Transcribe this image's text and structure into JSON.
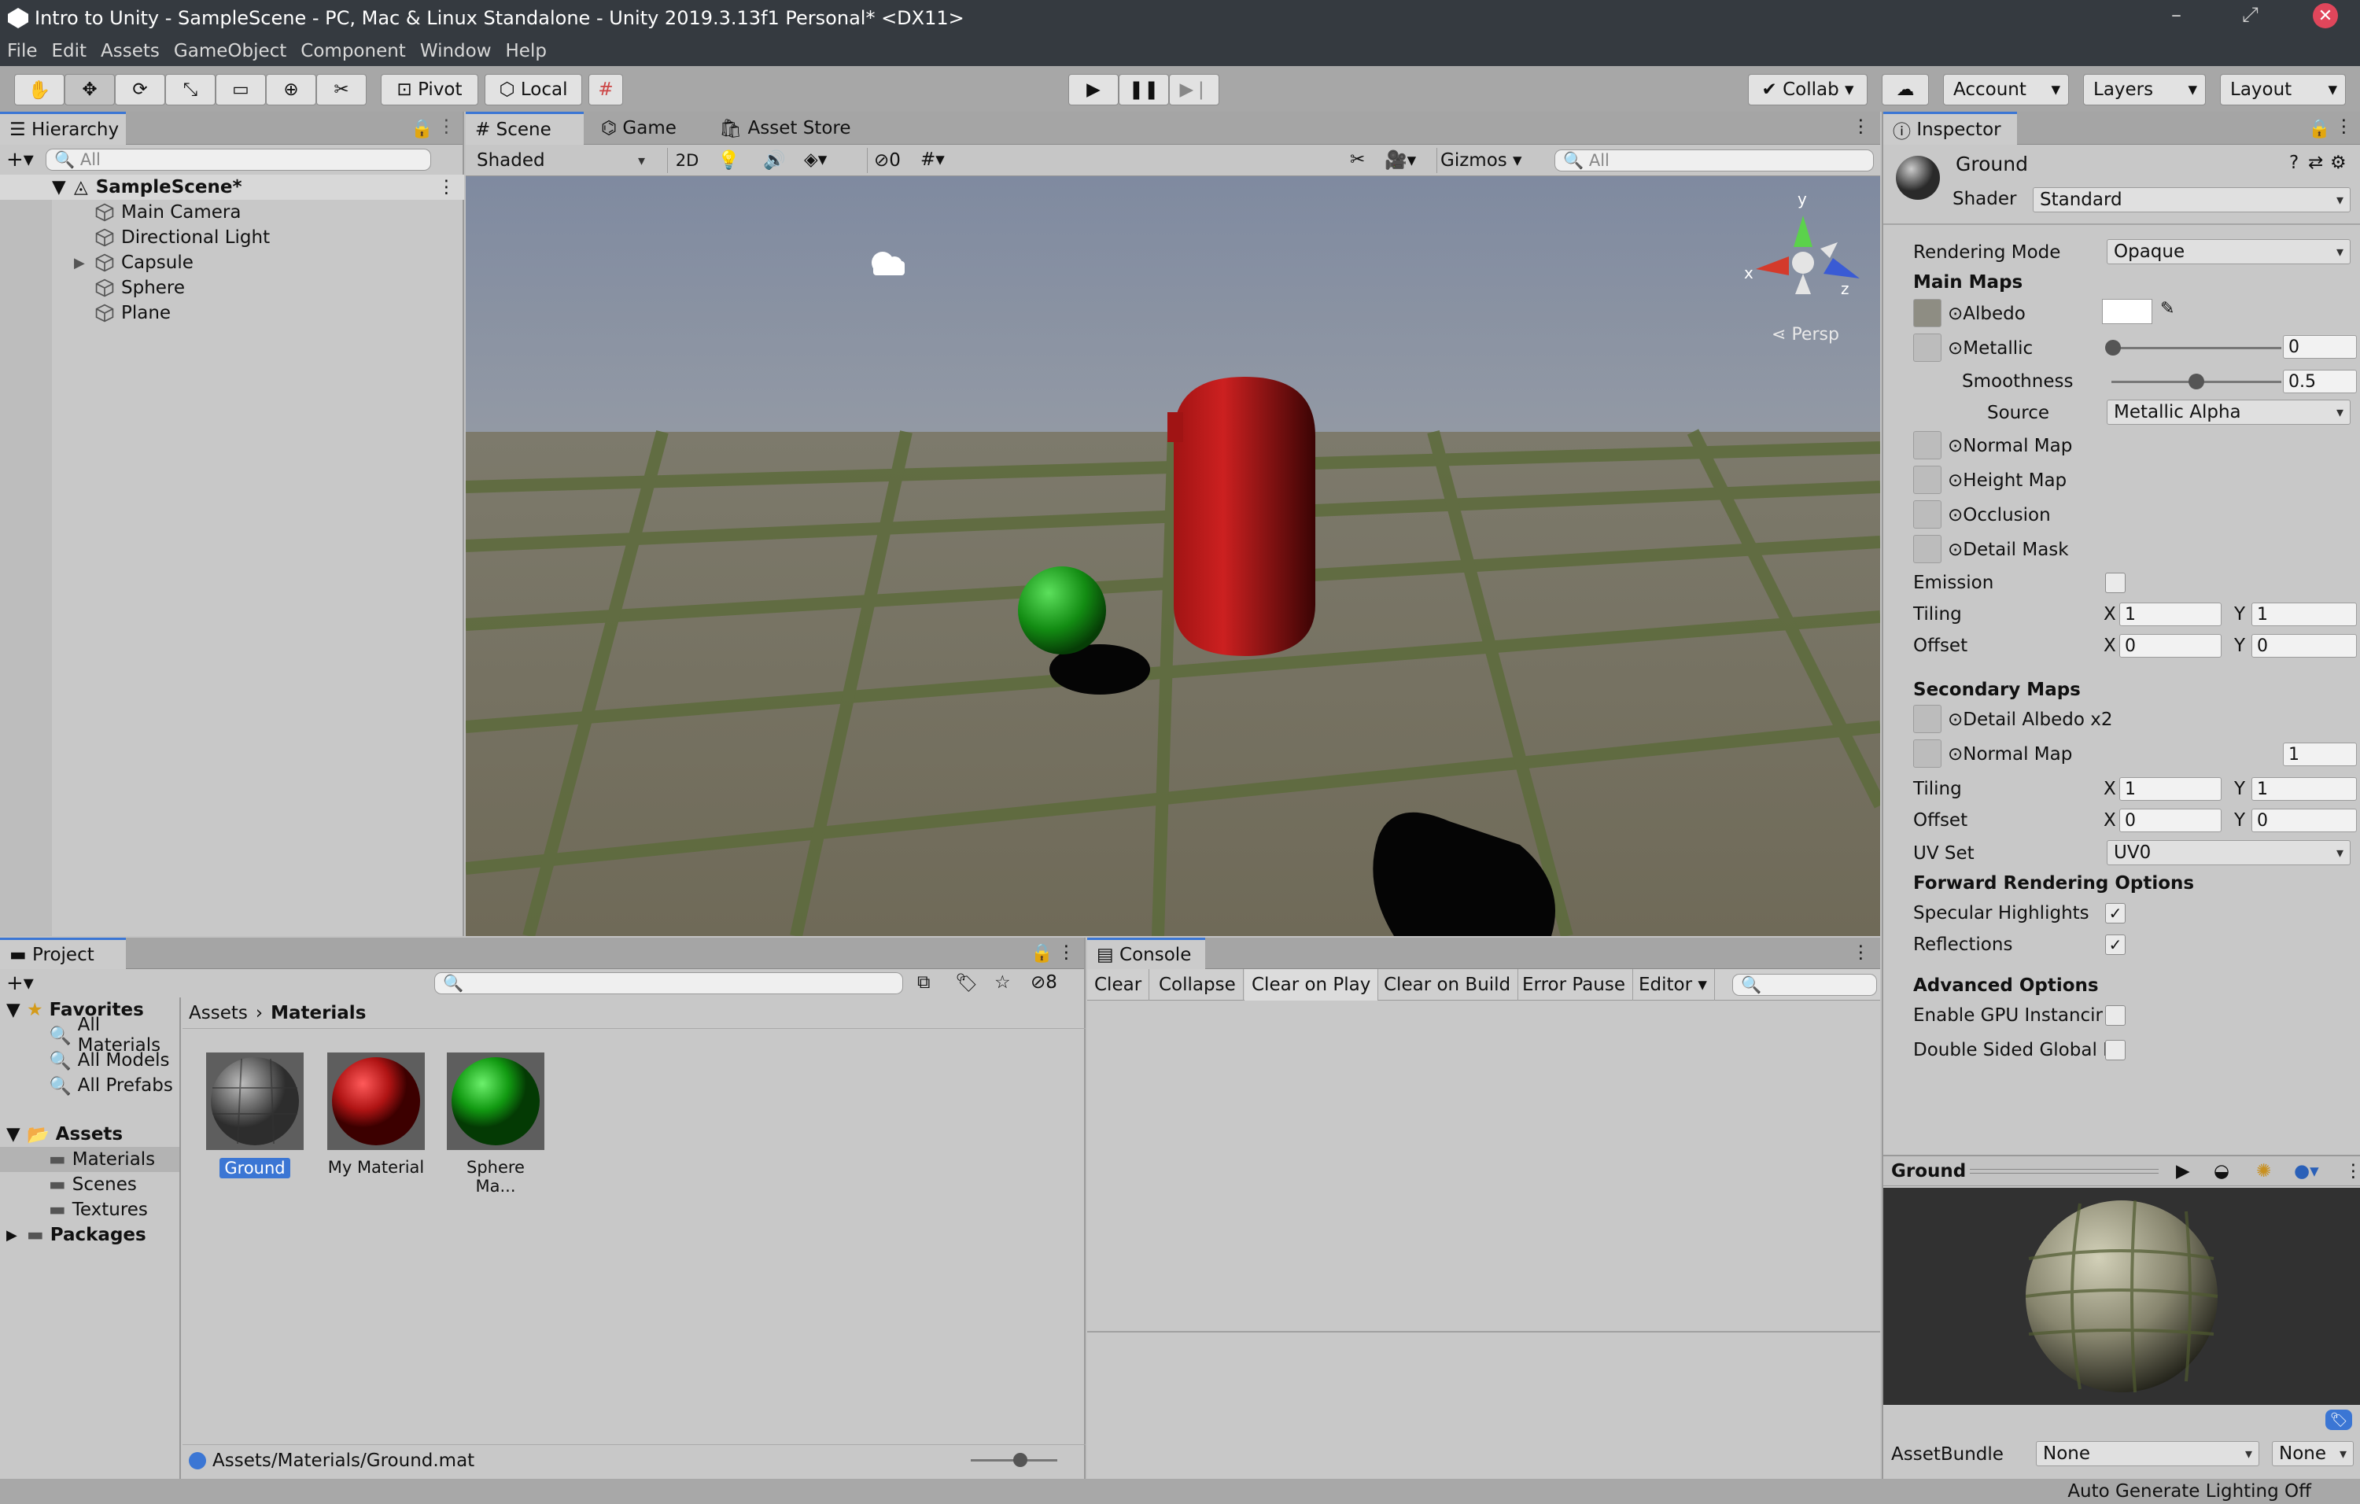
{
  "window": {
    "title": "Intro to Unity - SampleScene - PC, Mac & Linux Standalone - Unity 2019.3.13f1 Personal* <DX11>"
  },
  "menu": [
    "File",
    "Edit",
    "Assets",
    "GameObject",
    "Component",
    "Window",
    "Help"
  ],
  "toolbar": {
    "pivot": "Pivot",
    "local": "Local",
    "collab": "Collab",
    "account": "Account",
    "layers": "Layers",
    "layout": "Layout"
  },
  "hierarchy": {
    "tab": "Hierarchy",
    "search_placeholder": "All",
    "scene": "SampleScene*",
    "items": [
      "Main Camera",
      "Directional Light",
      "Capsule",
      "Sphere",
      "Plane"
    ]
  },
  "scene_view": {
    "tabs": [
      "Scene",
      "Game",
      "Asset Store"
    ],
    "shading": "Shaded",
    "mode2d": "2D",
    "hidden_count": "0",
    "gizmos": "Gizmos",
    "search_placeholder": "All",
    "persp": "Persp",
    "axis_x": "x",
    "axis_y": "y",
    "axis_z": "z"
  },
  "project": {
    "tab": "Project",
    "layer_count": "8",
    "favorites": "Favorites",
    "fav_items": [
      "All Materials",
      "All Models",
      "All Prefabs"
    ],
    "assets": "Assets",
    "asset_folders": [
      "Materials",
      "Scenes",
      "Textures"
    ],
    "packages": "Packages",
    "breadcrumb": [
      "Assets",
      "Materials"
    ],
    "materials": [
      "Ground",
      "My Material",
      "Sphere Ma..."
    ],
    "path": "Assets/Materials/Ground.mat"
  },
  "console": {
    "tab": "Console",
    "buttons": [
      "Clear",
      "Collapse",
      "Clear on Play",
      "Clear on Build",
      "Error Pause",
      "Editor"
    ]
  },
  "inspector": {
    "tab": "Inspector",
    "name": "Ground",
    "shader_label": "Shader",
    "shader": "Standard",
    "rendering_mode_label": "Rendering Mode",
    "rendering_mode": "Opaque",
    "main_maps": "Main Maps",
    "albedo": "Albedo",
    "metallic": "Metallic",
    "metallic_value": "0",
    "smoothness": "Smoothness",
    "smoothness_value": "0.5",
    "source": "Source",
    "source_value": "Metallic Alpha",
    "normal_map": "Normal Map",
    "height_map": "Height Map",
    "occlusion": "Occlusion",
    "detail_mask": "Detail Mask",
    "emission": "Emission",
    "tiling": "Tiling",
    "offset": "Offset",
    "x": "X",
    "y": "Y",
    "tiling_x": "1",
    "tiling_y": "1",
    "offset_x": "0",
    "offset_y": "0",
    "secondary_maps": "Secondary Maps",
    "detail_albedo": "Detail Albedo x2",
    "normal_map2": "Normal Map",
    "normal_scale": "1",
    "tiling2_x": "1",
    "tiling2_y": "1",
    "offset2_x": "0",
    "offset2_y": "0",
    "uv_set": "UV Set",
    "uv_set_value": "UV0",
    "forward_options": "Forward Rendering Options",
    "specular": "Specular Highlights",
    "reflections": "Reflections",
    "advanced": "Advanced Options",
    "gpu_instancing": "Enable GPU Instancir",
    "double_sided": "Double Sided Global I",
    "preview_title": "Ground",
    "assetbundle_label": "AssetBundle",
    "assetbundle": "None",
    "variant": "None"
  },
  "status": {
    "text": "Auto Generate Lighting Off"
  },
  "colors": {
    "accent": "#3b76d4",
    "titlebar": "#353a40",
    "panel": "#c8c8c8"
  }
}
